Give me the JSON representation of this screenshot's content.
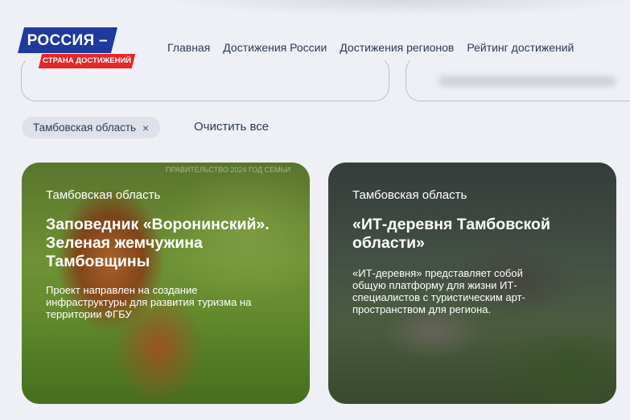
{
  "logo": {
    "top_text": "РОССИЯ –",
    "bottom_text": "СТРАНА ДОСТИЖЕНИЙ"
  },
  "nav": [
    "Главная",
    "Достижения России",
    "Достижения регионов",
    "Рейтинг достижений"
  ],
  "filters": {
    "chip_label": "Тамбовская область",
    "chip_remove_icon": "×",
    "clear_all": "Очистить все"
  },
  "cards": [
    {
      "region": "Тамбовская область",
      "title": "Заповедник «Воронинский». Зеленая жемчужина Тамбовщины",
      "description": "Проект направлен на создание инфраструктуры для развития туризма на территории ФГБУ",
      "watermark": "ПРАВИТЕЛЬСТВО 2024 ГОД СЕМЬИ"
    },
    {
      "region": "Тамбовская область",
      "title": "«ИТ-деревня Тамбовской области»",
      "description": "«ИТ-деревня» представляет собой общую платформу для жизни ИТ-специалистов с туристическим арт-пространством для региона."
    }
  ],
  "colors": {
    "brand_blue": "#1d3a9c",
    "brand_red": "#e3262a",
    "background": "#eef0f5"
  }
}
